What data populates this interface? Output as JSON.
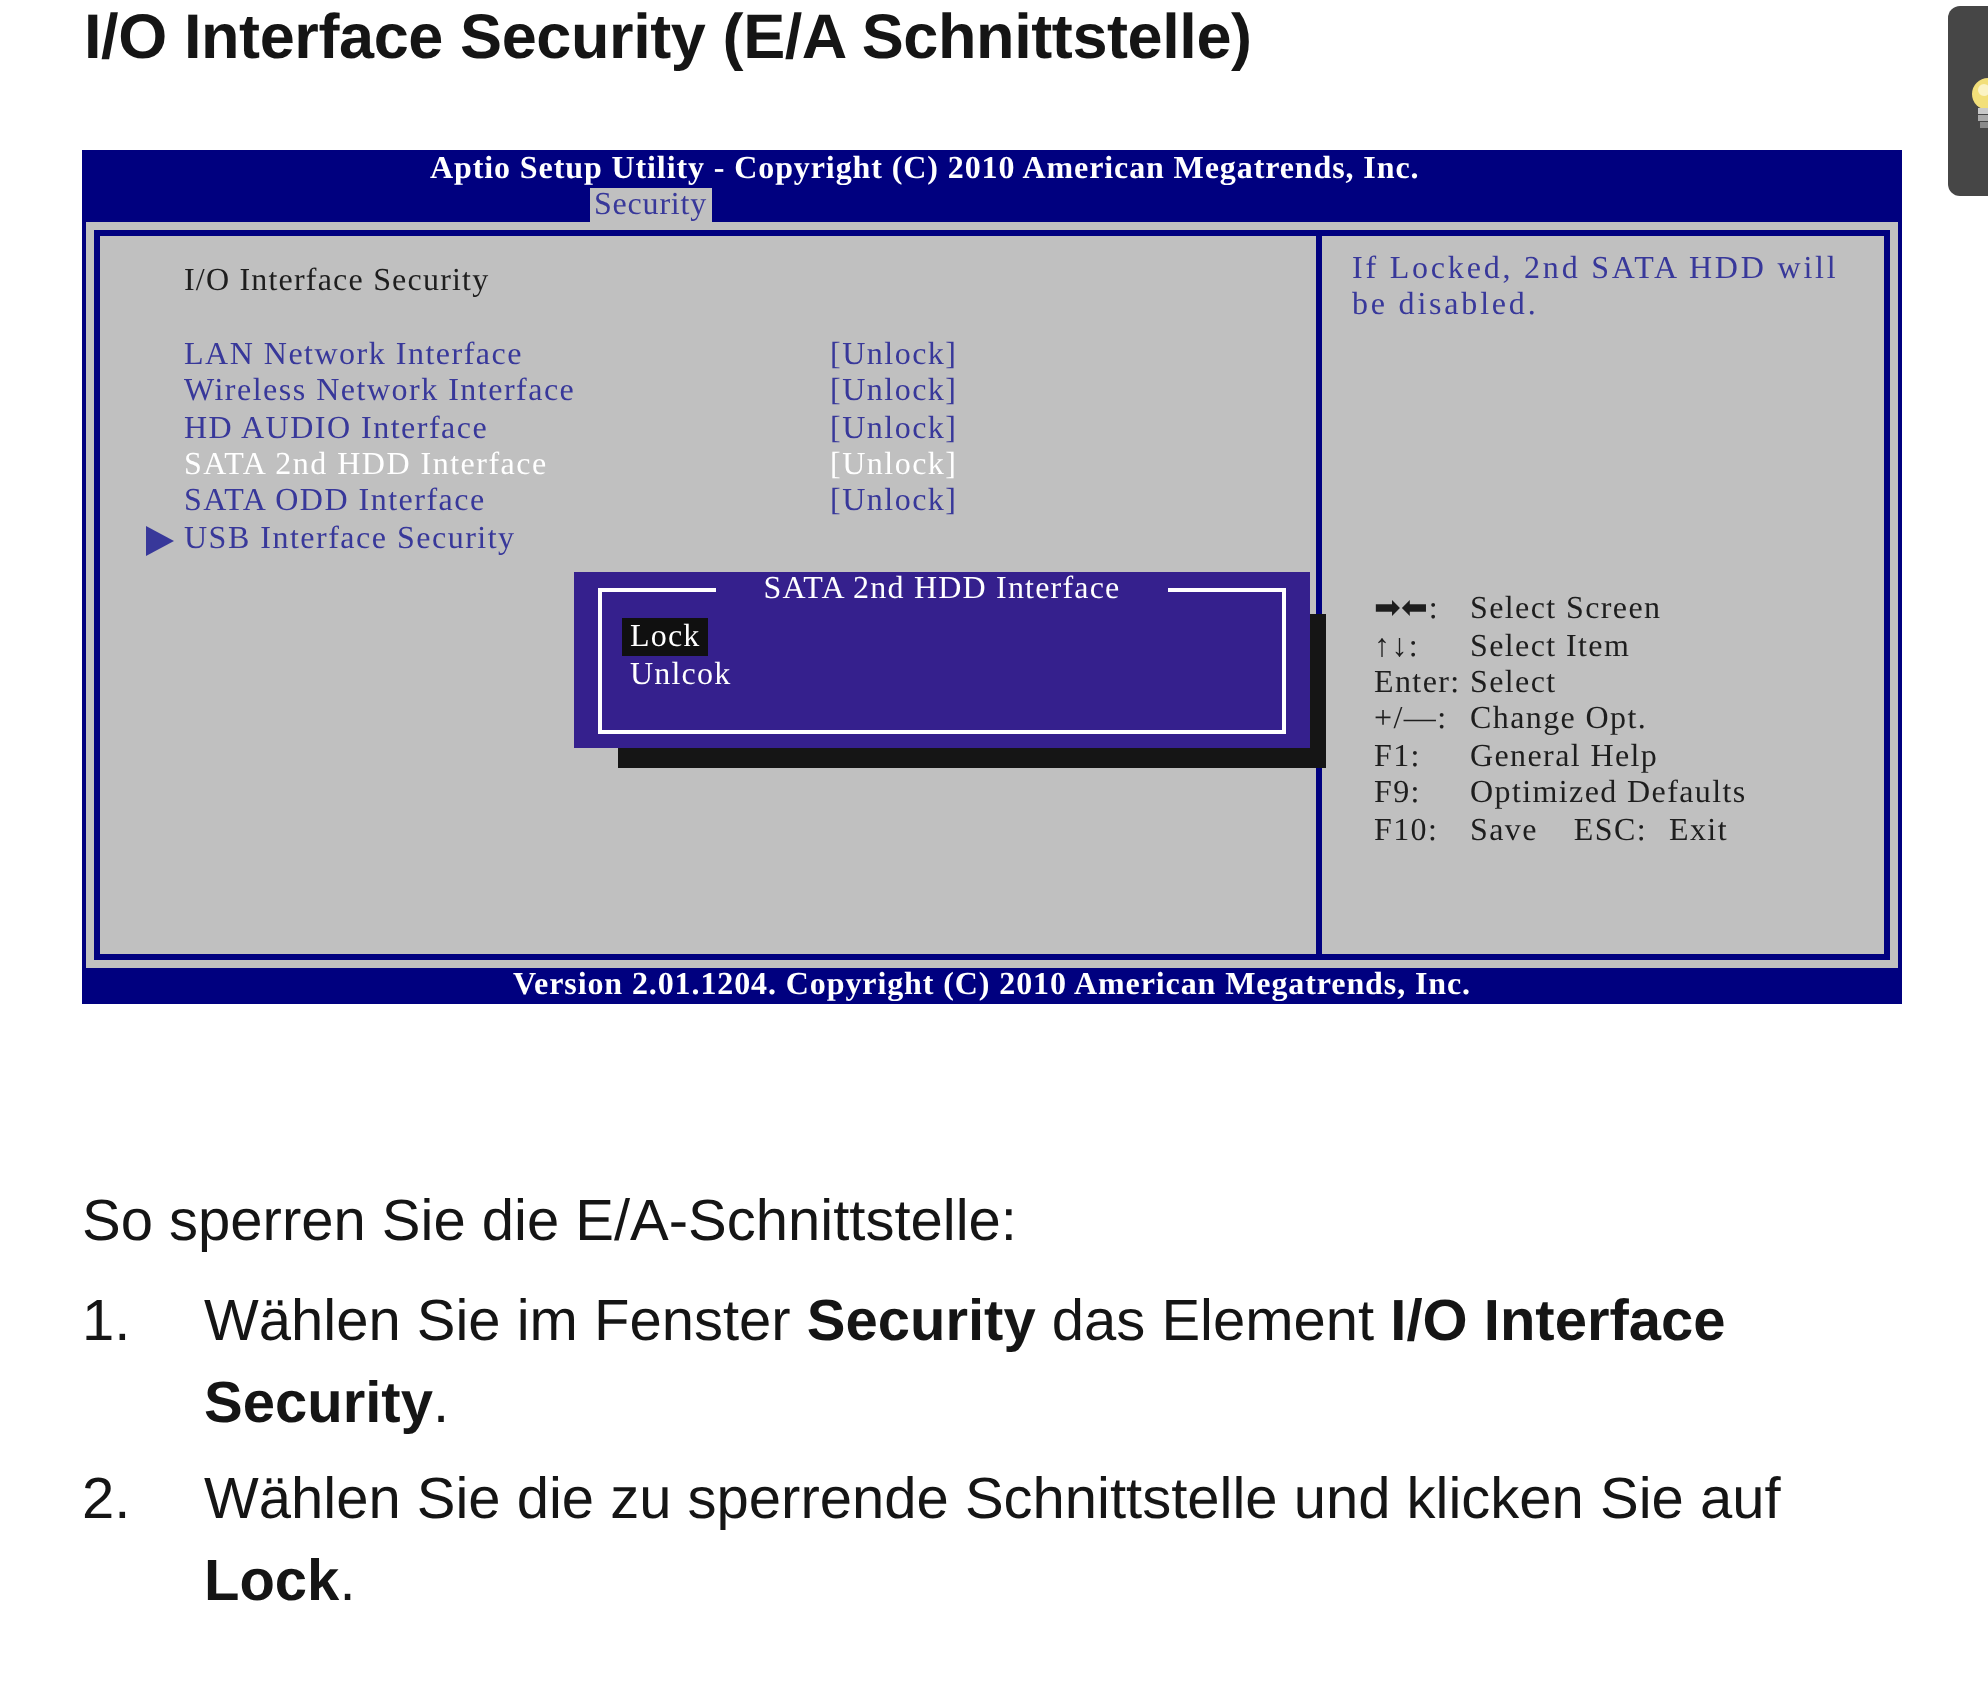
{
  "page_title": "I/O Interface Security (E/A Schnittstelle)",
  "bios": {
    "header": "Aptio Setup Utility - Copyright (C) 2010 American Megatrends, Inc.",
    "tabs": [
      {
        "label": "Security",
        "selected": true
      }
    ],
    "section_title": "I/O Interface Security",
    "items": [
      {
        "kind": "setting",
        "label": "LAN Network Interface",
        "value": "[Unlock]",
        "selected": false
      },
      {
        "kind": "setting",
        "label": "Wireless Network Interface",
        "value": "[Unlock]",
        "selected": false
      },
      {
        "kind": "setting",
        "label": "HD AUDIO Interface",
        "value": "[Unlock]",
        "selected": false
      },
      {
        "kind": "setting",
        "label": "SATA 2nd HDD Interface",
        "value": "[Unlock]",
        "selected": true
      },
      {
        "kind": "setting",
        "label": "SATA ODD Interface",
        "value": "[Unlock]",
        "selected": false
      },
      {
        "kind": "submenu",
        "label": "USB Interface Security",
        "selected": false
      }
    ],
    "popup": {
      "title": "SATA 2nd HDD Interface",
      "options": [
        {
          "label": "Lock",
          "selected": true
        },
        {
          "label": "Unlcok",
          "selected": false
        }
      ]
    },
    "help_text": "If Locked, 2nd SATA HDD will be disabled.",
    "key_legend": [
      [
        {
          "key": "➡⬅:",
          "action": "Select Screen"
        }
      ],
      [
        {
          "key": "↑↓:",
          "action": "Select Item"
        }
      ],
      [
        {
          "key": "Enter:",
          "action": "Select"
        }
      ],
      [
        {
          "key": "+/—:",
          "action": "Change Opt."
        }
      ],
      [
        {
          "key": "F1:",
          "action": "General Help"
        }
      ],
      [
        {
          "key": "F9:",
          "action": "Optimized Defaults"
        }
      ],
      [
        {
          "key": "F10:",
          "action": "Save"
        },
        {
          "key": "ESC:",
          "action": "Exit"
        }
      ]
    ],
    "footer": "Version 2.01.1204. Copyright (C) 2010 American Megatrends, Inc."
  },
  "instructions": {
    "intro": "So sperren Sie die E/A-Schnittstelle:",
    "steps": [
      {
        "number": "1.",
        "text": "Wählen Sie im Fenster **Security** das Element **I/O Interface Security**."
      },
      {
        "number": "2.",
        "text": "Wählen Sie die zu sperrende Schnittstelle und klicken Sie auf **Lock**."
      }
    ]
  }
}
